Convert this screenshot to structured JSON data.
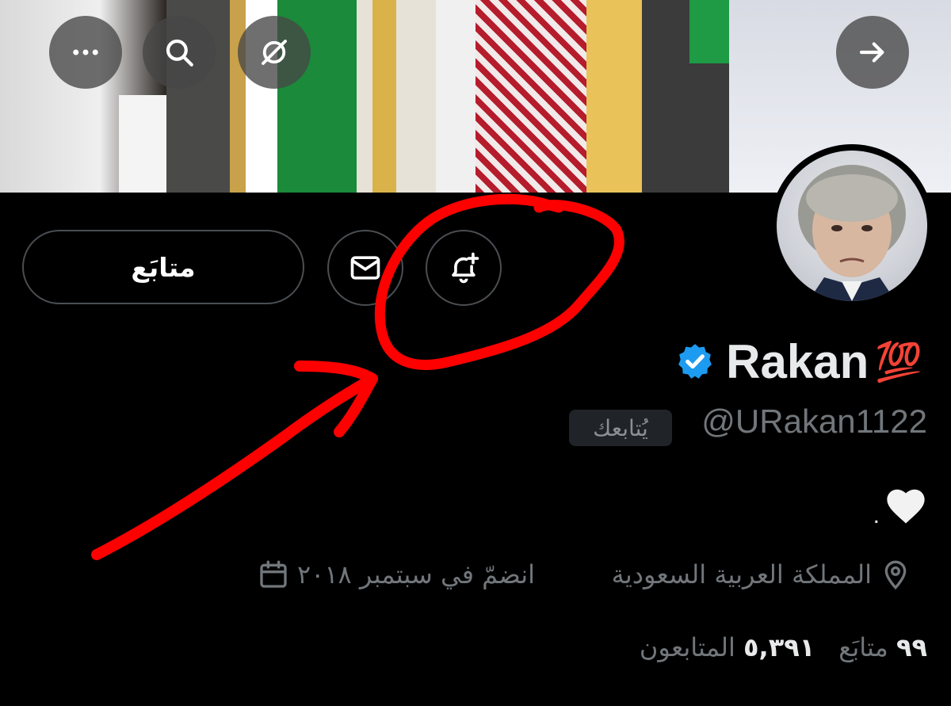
{
  "header": {
    "more_icon": "more-horizontal-icon",
    "search_icon": "search-icon",
    "grok_icon": "grok-icon",
    "forward_icon": "arrow-right-icon"
  },
  "actions": {
    "follow_label": "متابَع",
    "message_icon": "envelope-icon",
    "notify_icon": "bell-plus-icon"
  },
  "profile": {
    "name": "Rakan",
    "emoji": "💯",
    "verified_icon": "verified-badge-icon",
    "handle": "@URakan1122",
    "follows_you": "يُتابعك",
    "bio_emoji": "🤍",
    "bio_dot": ".",
    "location": "المملكة العربية السعودية",
    "joined": "انضمّ في سبتمبر ٢٠١٨",
    "following_count": "٩٩",
    "following_label": "متابَع",
    "followers_count": "٥,٣٩١",
    "followers_label": "المتابعون"
  },
  "colors": {
    "background": "#000000",
    "verified_blue": "#1d9bf0",
    "annotation_red": "#ff0000",
    "muted_text": "#71767b"
  }
}
